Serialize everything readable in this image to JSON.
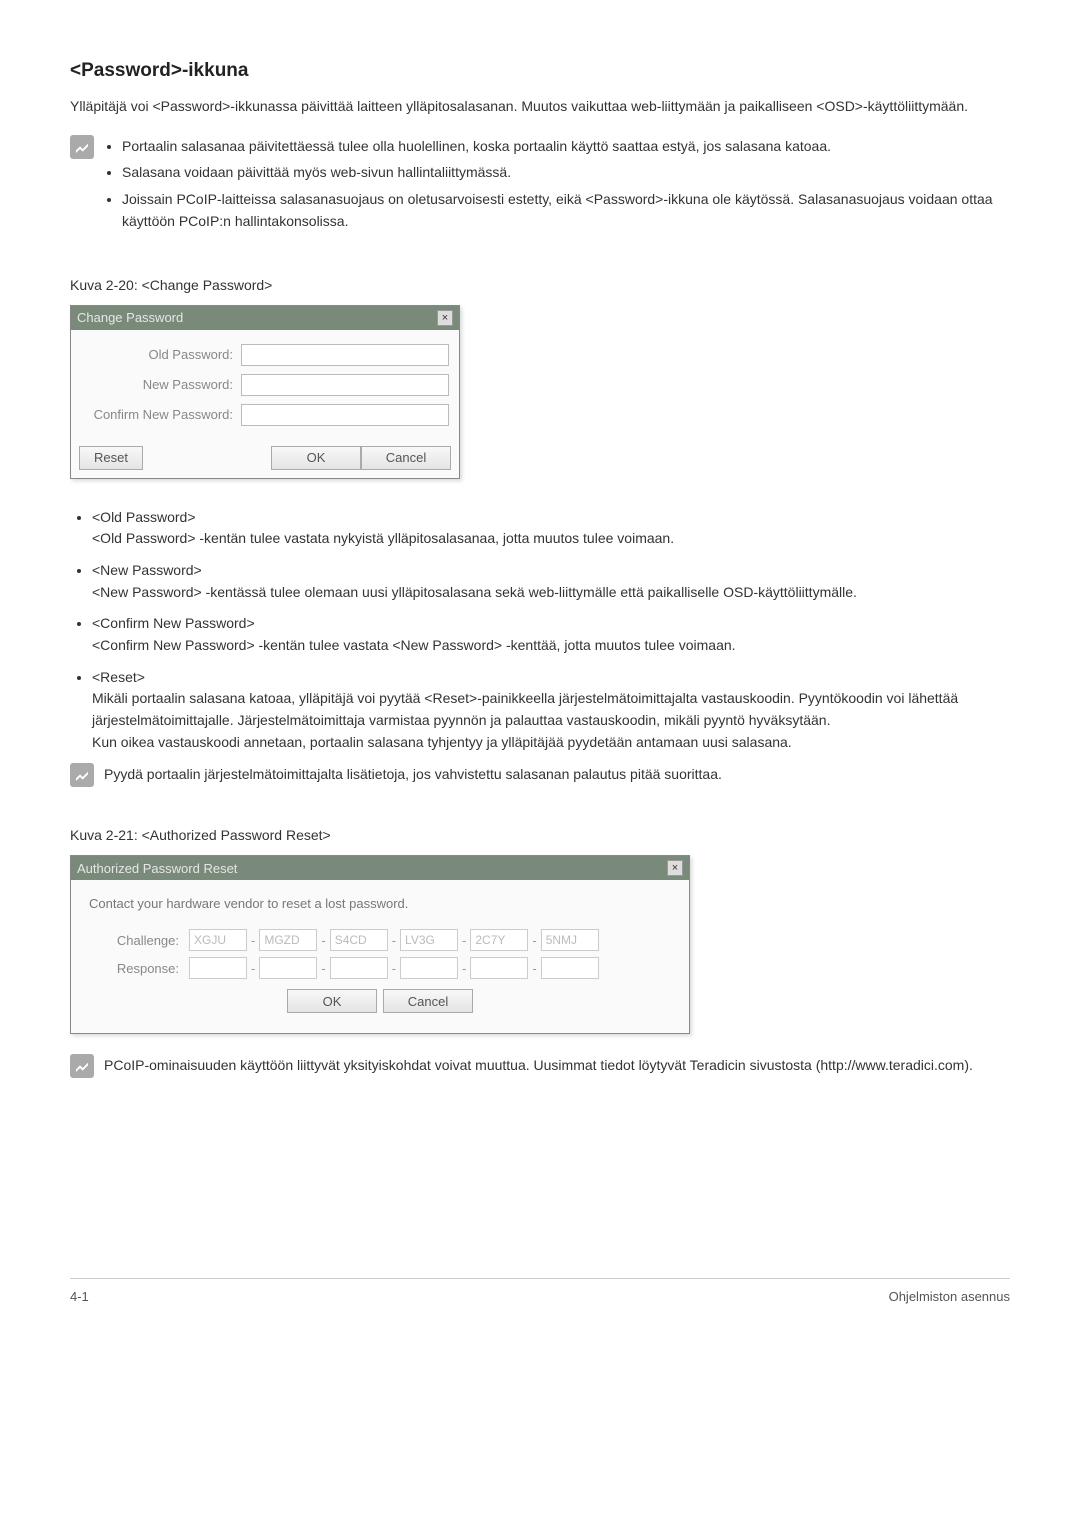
{
  "heading": "<Password>-ikkuna",
  "intro": "Ylläpitäjä voi <Password>-ikkunassa päivittää laitteen ylläpitosalasanan. Muutos vaikuttaa web-liittymään ja paikalliseen <OSD>-käyttöliittymään.",
  "note1": {
    "items": [
      "Portaalin salasanaa päivitettäessä tulee olla huolellinen, koska portaalin käyttö saattaa estyä, jos salasana katoaa.",
      "Salasana voidaan päivittää myös web-sivun hallintaliittymässä.",
      "Joissain PCoIP-laitteissa salasanasuojaus on oletusarvoisesti estetty, eikä <Password>-ikkuna ole käytössä. Salasanasuojaus voidaan ottaa käyttöön PCoIP:n hallintakonsolissa."
    ]
  },
  "fig1_caption": "Kuva 2-20: <Change Password>",
  "dialog1": {
    "title": "Change Password",
    "close": "×",
    "old_label": "Old Password:",
    "new_label": "New Password:",
    "confirm_label": "Confirm New Password:",
    "reset": "Reset",
    "ok": "OK",
    "cancel": "Cancel"
  },
  "defs": [
    {
      "term": "<Old Password>",
      "desc": "<Old Password> -kentän tulee vastata nykyistä ylläpitosalasanaa, jotta muutos tulee voimaan."
    },
    {
      "term": "<New Password>",
      "desc": "<New Password> -kentässä tulee olemaan uusi ylläpitosalasana sekä web-liittymälle että paikalliselle OSD-käyttöliittymälle."
    },
    {
      "term": "<Confirm New Password>",
      "desc": "<Confirm New Password> -kentän tulee vastata <New Password> -kenttää, jotta muutos tulee voimaan."
    },
    {
      "term": "<Reset>",
      "desc": "Mikäli portaalin salasana katoaa, ylläpitäjä voi pyytää <Reset>-painikkeella järjestelmätoimittajalta vastauskoodin. Pyyntökoodin voi lähettää järjestelmätoimittajalle. Järjestelmätoimittaja varmistaa pyynnön ja palauttaa vastauskoodin, mikäli pyyntö hyväksytään.",
      "desc2": "Kun oikea vastauskoodi annetaan, portaalin salasana tyhjentyy ja ylläpitäjää pyydetään antamaan uusi salasana."
    }
  ],
  "note2": "Pyydä portaalin järjestelmätoimittajalta lisätietoja, jos vahvistettu salasanan palautus pitää suorittaa.",
  "fig2_caption": "Kuva 2-21: <Authorized Password Reset>",
  "dialog2": {
    "title": "Authorized Password Reset",
    "close": "×",
    "contact": "Contact your hardware vendor to reset a lost password.",
    "challenge_label": "Challenge:",
    "response_label": "Response:",
    "segments": [
      "XGJU",
      "MGZD",
      "S4CD",
      "LV3G",
      "2C7Y",
      "5NMJ"
    ],
    "ok": "OK",
    "cancel": "Cancel"
  },
  "note3": "PCoIP-ominaisuuden käyttöön liittyvät yksityiskohdat voivat muuttua. Uusimmat tiedot löytyvät Teradicin sivustosta (http://www.teradici.com).",
  "footer": {
    "left": "4-1",
    "right": "Ohjelmiston asennus"
  }
}
